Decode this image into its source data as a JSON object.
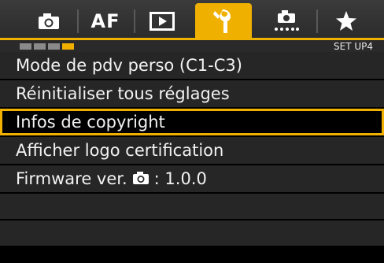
{
  "tabs": [
    {
      "name": "camera",
      "icon": "camera-icon",
      "label": ""
    },
    {
      "name": "af",
      "label": "AF"
    },
    {
      "name": "playback",
      "icon": "play-icon",
      "label": ""
    },
    {
      "name": "setup",
      "icon": "wrench-icon",
      "label": "",
      "active": true
    },
    {
      "name": "custom",
      "icon": "custom-function-icon",
      "label": ""
    },
    {
      "name": "mymenu",
      "icon": "star-icon",
      "label": ""
    }
  ],
  "page_indicator": {
    "total": 4,
    "active": 4,
    "label": "SET UP4"
  },
  "menu": {
    "items": [
      {
        "label": "Mode de pdv perso (C1-C3)"
      },
      {
        "label": "Réinitialiser tous réglages"
      },
      {
        "label": "Infos de copyright",
        "selected": true
      },
      {
        "label": "Afficher logo certification"
      },
      {
        "label_prefix": "Firmware ver.",
        "label_suffix": ": 1.0.0",
        "icon": "camera-icon"
      }
    ]
  },
  "colors": {
    "accent": "#f0b000",
    "row_bg": "#262626",
    "text": "#f2f2f2"
  }
}
